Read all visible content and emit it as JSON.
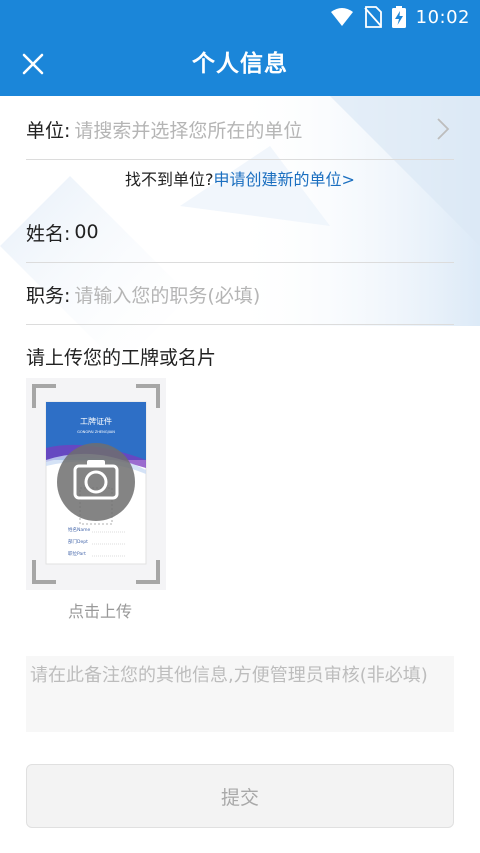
{
  "status_bar": {
    "time": "10:02",
    "icons": [
      "wifi-icon",
      "no-sim-icon",
      "battery-charging-icon"
    ]
  },
  "header": {
    "title": "个人信息",
    "close_icon": "close-icon",
    "color": "#1b86d9"
  },
  "form": {
    "unit": {
      "label": "单位:",
      "placeholder": "请搜索并选择您所在的单位",
      "icon": "chevron-right-icon"
    },
    "not_found": {
      "text": "找不到单位?",
      "link": "申请创建新的单位>"
    },
    "name": {
      "label": "姓名:",
      "value": "00"
    },
    "position": {
      "label": "职务:",
      "placeholder": "请输入您的职务(必填)"
    }
  },
  "upload": {
    "title": "请上传您的工牌或名片",
    "caption": "点击上传",
    "camera_icon": "camera-icon",
    "card": {
      "title": "工牌证件",
      "subtitle": "GONGPAI ZHENGJIAN",
      "fields": [
        "姓名Name",
        "部门Dept",
        "职位Part"
      ]
    }
  },
  "remark": {
    "placeholder": "请在此备注您的其他信息,方便管理员审核(非必填)"
  },
  "submit": {
    "label": "提交"
  },
  "colors": {
    "accent": "#1b86d9",
    "link": "#1b6fc0",
    "placeholder": "#b5b5b5"
  }
}
